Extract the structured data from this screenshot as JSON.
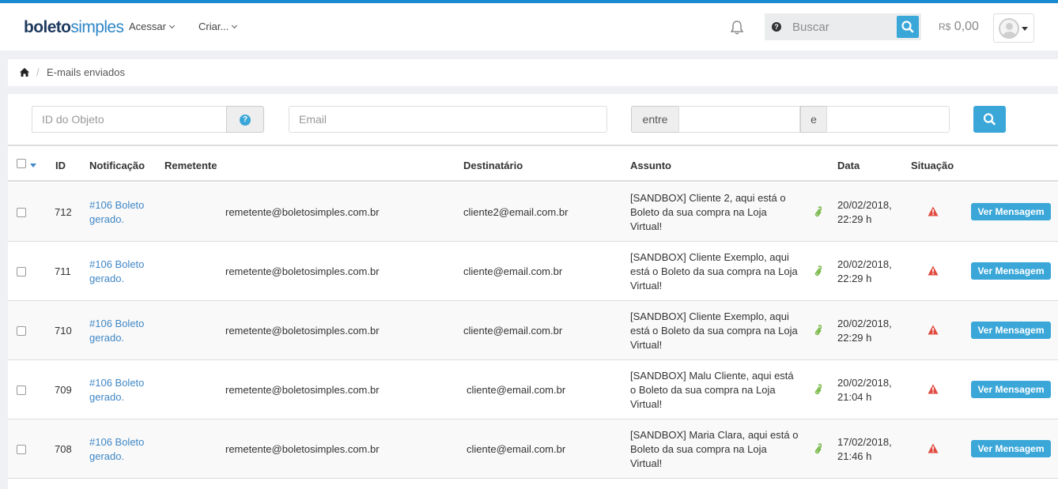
{
  "brand": {
    "part1": "boleto",
    "part2": "simples"
  },
  "nav": {
    "menu1": "Acessar",
    "menu2": "Criar..."
  },
  "search": {
    "placeholder": "Buscar"
  },
  "balance": {
    "currency": "R$",
    "amount": "0,00"
  },
  "breadcrumb": {
    "current": "E-mails enviados",
    "separator": "/"
  },
  "filters": {
    "object_id_placeholder": "ID do Objeto",
    "email_placeholder": "Email",
    "between_label": "entre",
    "and_label": "e"
  },
  "table": {
    "columns": [
      "ID",
      "Notificação",
      "Remetente",
      "Destinatário",
      "Assunto",
      "Data",
      "Situação"
    ],
    "action_label": "Ver Mensagem",
    "rows": [
      {
        "id": "712",
        "notification": "#106 Boleto gerado.",
        "sender": "remetente@boletosimples.com.br",
        "recipient": "cliente2@email.com.br",
        "subject": "[SANDBOX] Cliente 2, aqui está o Boleto da sua compra na Loja Virtual!",
        "date": "20/02/2018,",
        "time": "22:29 h"
      },
      {
        "id": "711",
        "notification": "#106 Boleto gerado.",
        "sender": "remetente@boletosimples.com.br",
        "recipient": "cliente@email.com.br",
        "subject": "[SANDBOX] Cliente Exemplo, aqui está o Boleto da sua compra na Loja Virtual!",
        "date": "20/02/2018,",
        "time": "22:29 h"
      },
      {
        "id": "710",
        "notification": "#106 Boleto gerado.",
        "sender": "remetente@boletosimples.com.br",
        "recipient": "cliente@email.com.br",
        "subject": "[SANDBOX] Cliente Exemplo, aqui está o Boleto da sua compra na Loja Virtual!",
        "date": "20/02/2018,",
        "time": "22:29 h"
      },
      {
        "id": "709",
        "notification": "#106 Boleto gerado.",
        "sender": "remetente@boletosimples.com.br",
        "recipient": "cliente@email.com.br",
        "subject": "[SANDBOX] Malu Cliente, aqui está o Boleto da sua compra na Loja Virtual!",
        "date": "20/02/2018,",
        "time": "21:04 h"
      },
      {
        "id": "708",
        "notification": "#106 Boleto gerado.",
        "sender": "remetente@boletosimples.com.br",
        "recipient": "cliente@email.com.br",
        "subject": "[SANDBOX] Maria Clara, aqui está o Boleto da sua compra na Loja Virtual!",
        "date": "17/02/2018,",
        "time": "21:46 h"
      }
    ]
  },
  "colors": {
    "accent": "#3aa7d8",
    "link": "#3f87c6",
    "warning": "#e04a3f",
    "attachment": "#7ab94a",
    "topline": "#1a8ad1"
  }
}
